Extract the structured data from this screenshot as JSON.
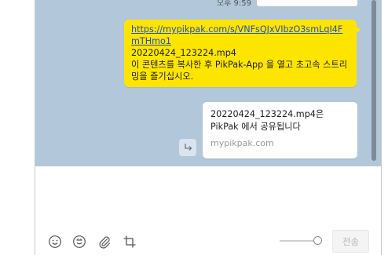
{
  "chat": {
    "previous_time": "오후 9:59",
    "sent_message": {
      "link": "https://mypikpak.com/s/VNFsQJxVIbzO3smLqI4FmTHmo1",
      "filename": "20220424_123224.mp4",
      "text": "이 콘텐츠를 복사한 후 PikPak-App 을 열고 초고속 스트리밍을 즐기십시오."
    },
    "link_preview": {
      "title_line1": "20220424_123224.mp4은",
      "title_line2": "PikPak 에서 공유됩니다",
      "domain": "mypikpak.com"
    },
    "share_icon": "share-arrow-icon"
  },
  "input": {
    "value": "",
    "send_label": "전송"
  },
  "toolbar": {
    "icons": [
      "emoji-icon",
      "emoticon-icon",
      "attach-icon",
      "crop-icon"
    ]
  },
  "colors": {
    "chat_background": "#b2c7d9",
    "my_bubble": "#fee500",
    "link": "#2050b8"
  }
}
